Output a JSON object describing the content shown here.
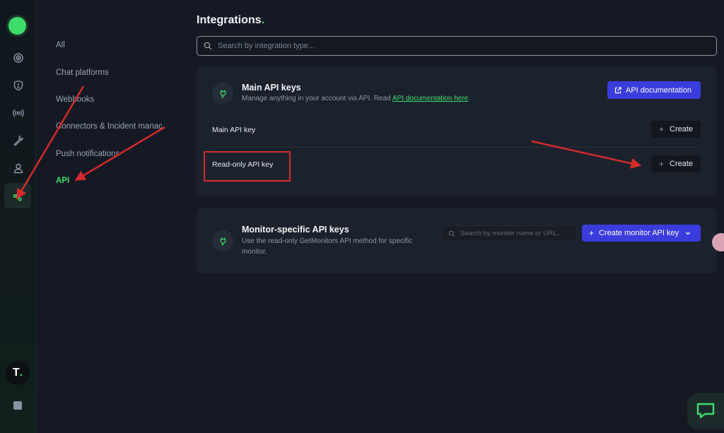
{
  "rail": {
    "avatar_initial": "T",
    "avatar_dot": "."
  },
  "subnav": {
    "items": [
      {
        "label": "All"
      },
      {
        "label": "Chat platforms"
      },
      {
        "label": "Webhooks"
      },
      {
        "label": "Connectors & Incident manag"
      },
      {
        "label": "Push notifications"
      },
      {
        "label": "API"
      }
    ],
    "active": "API"
  },
  "page": {
    "title": "Integrations",
    "title_dot": ".",
    "search_placeholder": "Search by integration type..."
  },
  "main_api": {
    "title": "Main API keys",
    "desc_prefix": "Manage anything in your account via API. Read ",
    "desc_link": "API documentation here",
    "desc_suffix": ".",
    "doc_button": "API documentation",
    "rows": [
      {
        "label": "Main API key",
        "button": "Create"
      },
      {
        "label": "Read-only API key",
        "button": "Create"
      }
    ]
  },
  "monitor_api": {
    "title": "Monitor-specific API keys",
    "desc": "Use the read-only GetMonitors API method for specific monitor.",
    "search_placeholder": "Search by monitor name or URL...",
    "create_button": "Create monitor API key"
  },
  "colors": {
    "accent_green": "#3ddc6b",
    "primary_button": "#3a3ddb",
    "annotation_red": "#d42b2b"
  },
  "icons": [
    "status-dot-icon",
    "target-icon",
    "shield-icon",
    "broadcast-icon",
    "wrench-icon",
    "user-icon",
    "share-icon",
    "logout-icon",
    "search-icon",
    "plug-icon",
    "external-link-icon",
    "plus-icon",
    "chevron-down-icon",
    "chat-icon"
  ]
}
